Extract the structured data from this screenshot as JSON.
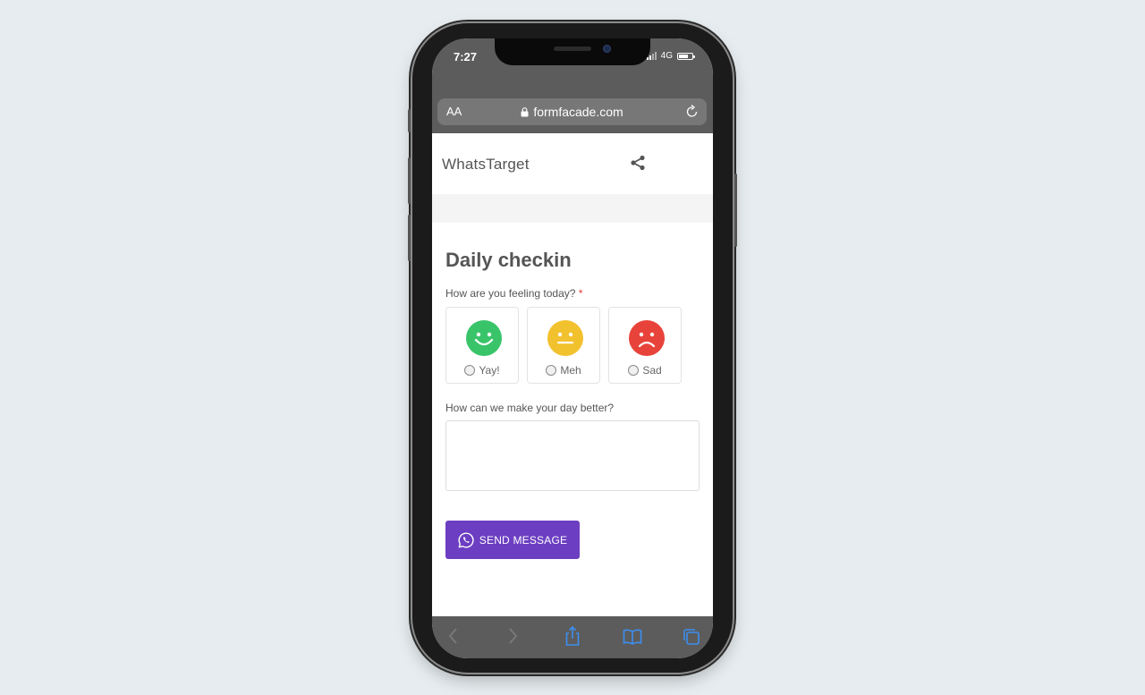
{
  "status_bar": {
    "time": "7:27",
    "network": "4G"
  },
  "browser": {
    "text_size_label": "AA",
    "url": "formfacade.com"
  },
  "site": {
    "brand": "WhatsTarget"
  },
  "form": {
    "title": "Daily checkin",
    "question1": {
      "label": "How are you feeling today?",
      "required_mark": "*",
      "options": [
        {
          "label": "Yay!",
          "color": "#3ac46a"
        },
        {
          "label": "Meh",
          "color": "#f2c12e"
        },
        {
          "label": "Sad",
          "color": "#e8433a"
        }
      ]
    },
    "question2": {
      "label": "How can we make your day better?",
      "value": ""
    },
    "submit_label": "SEND MESSAGE",
    "submit_color": "#6c3ec1"
  },
  "toolbar_icons": [
    "back-icon",
    "forward-icon",
    "share-icon",
    "bookmarks-icon",
    "tabs-icon"
  ]
}
